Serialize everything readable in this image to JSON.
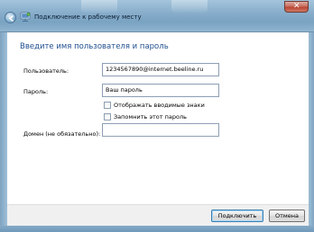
{
  "window": {
    "title": "Подключение к рабочему месту",
    "close_symbol": "✕",
    "icon": "network-connection-icon"
  },
  "form": {
    "heading": "Введите имя пользователя и пароль",
    "username_label": "Пользователь:",
    "username_value": "1234567890@internet.beeline.ru",
    "password_label": "Пароль:",
    "password_value": "Ваш пароль",
    "show_chars_label": "Отображать вводимые знаки",
    "show_chars_checked": false,
    "remember_label": "Запомнить этот пароль",
    "remember_checked": false,
    "domain_label": "Домен (не обязательно):",
    "domain_value": ""
  },
  "buttons": {
    "connect": "Подключить",
    "cancel": "Отмена"
  },
  "colors": {
    "heading": "#1f4e8f",
    "glass": "#88aecb"
  }
}
